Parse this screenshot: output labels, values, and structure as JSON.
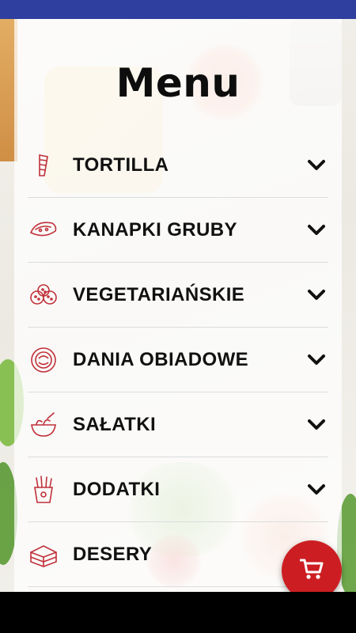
{
  "header": {
    "title": "Menu"
  },
  "menu": {
    "items": [
      {
        "label": "TORTILLA",
        "icon": "tortilla-icon"
      },
      {
        "label": "KANAPKI GRUBY",
        "icon": "sandwich-icon"
      },
      {
        "label": "VEGETARIAŃSKIE",
        "icon": "falafel-icon"
      },
      {
        "label": "DANIA OBIADOWE",
        "icon": "dinner-plate-icon"
      },
      {
        "label": "SAŁATKI",
        "icon": "salad-bowl-icon"
      },
      {
        "label": "DODATKI",
        "icon": "fries-icon"
      },
      {
        "label": "DESERY",
        "icon": "cake-icon"
      }
    ]
  },
  "cart": {
    "icon": "shopping-cart-icon"
  },
  "colors": {
    "status_bar": "#2f3fa0",
    "accent": "#cc1e22",
    "icon_stroke": "#c0303a",
    "text": "#111111"
  }
}
